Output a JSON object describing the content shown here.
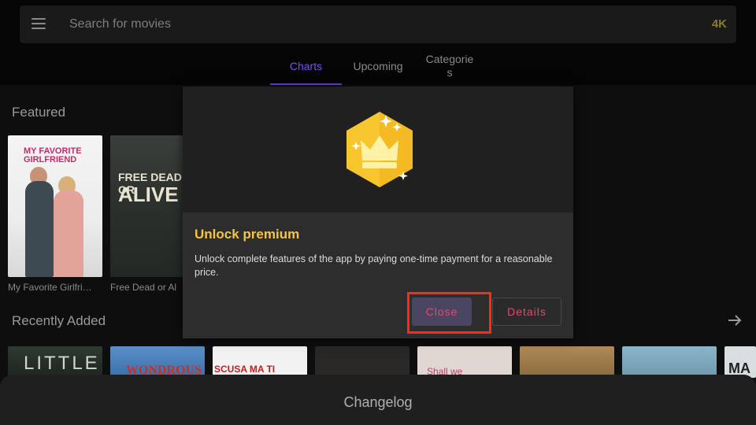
{
  "search": {
    "placeholder": "Search for movies",
    "badge": "4K"
  },
  "tabs": [
    {
      "label": "Charts",
      "active": true
    },
    {
      "label": "Upcoming",
      "active": false
    },
    {
      "label": "Categorie\ns",
      "active": false
    }
  ],
  "featured": {
    "title": "Featured",
    "items": [
      {
        "caption": "My Favorite Girlfri…",
        "poster_text": "MY FAVORITE GIRLFRIEND"
      },
      {
        "caption": "Free Dead or Al",
        "poster_text_1": "FREE DEAD OR",
        "poster_text_2": "ALIVE"
      }
    ]
  },
  "recently_added": {
    "title": "Recently Added",
    "items": [
      {
        "poster_text": "LITTLE"
      },
      {
        "poster_text": "WONDROUS"
      },
      {
        "poster_text": "SCUSA MA TI CHIAMO"
      },
      {
        "poster_text": ""
      },
      {
        "poster_text": "Shall we"
      },
      {
        "poster_text": ""
      },
      {
        "poster_text": ""
      },
      {
        "poster_text": "MA"
      }
    ]
  },
  "dialog": {
    "title": "Unlock premium",
    "text": "Unlock complete features of the app by paying one-time payment for a reasonable price.",
    "close_label": "Close",
    "details_label": "Details"
  },
  "sheet": {
    "title": "Changelog"
  },
  "colors": {
    "accent": "#7c4dff",
    "premium_gold": "#f5c542",
    "button_text": "#e04a6e",
    "highlight": "#ff2a12"
  }
}
